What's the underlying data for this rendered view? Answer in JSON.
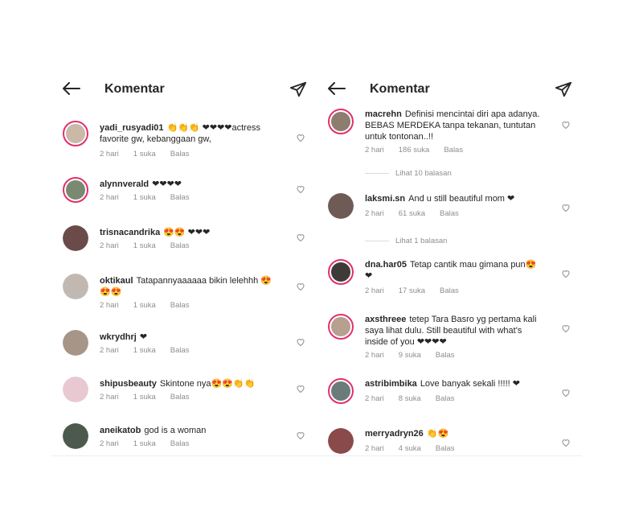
{
  "left": {
    "title": "Komentar",
    "comments": [
      {
        "user": "yadi_rusyadi01",
        "text": "👏👏👏 ❤❤❤❤actress favorite gw, kebanggaan gw,",
        "age": "2 hari",
        "likes": "1 suka",
        "reply": "Balas",
        "color": "#c9b9a6"
      },
      {
        "user": "alynnverald",
        "text": "❤❤❤❤",
        "age": "2 hari",
        "likes": "1 suka",
        "reply": "Balas",
        "color": "#7a8a70"
      },
      {
        "user": "trisnacandrika",
        "text": "😍😍 ❤❤❤",
        "age": "2 hari",
        "likes": "1 suka",
        "reply": "Balas",
        "color": "#6b4a4a"
      },
      {
        "user": "oktikaul",
        "text": "Tatapannyaaaaaa bikin lelehhh 😍😍😍",
        "age": "2 hari",
        "likes": "1 suka",
        "reply": "Balas",
        "color": "#c2b8b2"
      },
      {
        "user": "wkrydhrj",
        "text": "❤",
        "age": "2 hari",
        "likes": "1 suka",
        "reply": "Balas",
        "color": "#a79588"
      },
      {
        "user": "shipusbeauty",
        "text": "Skintone nya😍😍👏👏",
        "age": "2 hari",
        "likes": "1 suka",
        "reply": "Balas",
        "color": "#e8c9d2"
      },
      {
        "user": "aneikatob",
        "text": "god is a woman",
        "age": "2 hari",
        "likes": "1 suka",
        "reply": "Balas",
        "color": "#4c5a4e"
      }
    ]
  },
  "right": {
    "title": "Komentar",
    "comments": [
      {
        "user": "macrehn",
        "text": "Definisi mencintai diri apa adanya. BEBAS MERDEKA tanpa tekanan, tuntutan untuk tontonan..!!",
        "age": "2 hari",
        "likes": "186 suka",
        "reply": "Balas",
        "color": "#8c7d6e"
      },
      {
        "user": "laksmi.sn",
        "text": "And u still beautiful mom ❤",
        "age": "2 hari",
        "likes": "61 suka",
        "reply": "Balas",
        "color": "#6f5b55"
      },
      {
        "user": "dna.har05",
        "text": "Tetap cantik mau gimana pun😍❤",
        "age": "2 hari",
        "likes": "17 suka",
        "reply": "Balas",
        "color": "#3d3a38"
      },
      {
        "user": "axsthreee",
        "text": "tetep Tara Basro yg pertama kali saya lihat dulu. Still beautiful with what's inside of you ❤❤❤❤",
        "age": "2 hari",
        "likes": "9 suka",
        "reply": "Balas",
        "color": "#b7a08f"
      },
      {
        "user": "astribimbika",
        "text": "Love banyak sekali !!!!! ❤",
        "age": "2 hari",
        "likes": "8 suka",
        "reply": "Balas",
        "color": "#6a7b7a"
      },
      {
        "user": "merryadryn26",
        "text": "👏😍",
        "age": "2 hari",
        "likes": "4 suka",
        "reply": "Balas",
        "color": "#8a4a4a"
      }
    ],
    "replies": [
      "Lihat 10 balasan",
      "Lihat 1 balasan"
    ]
  }
}
